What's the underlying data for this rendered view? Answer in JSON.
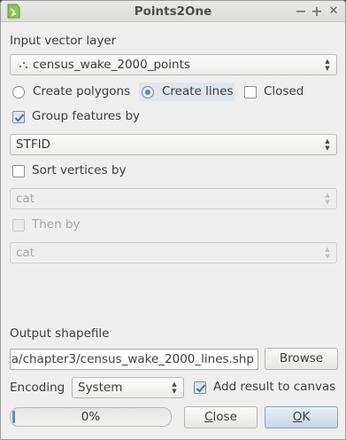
{
  "window": {
    "title": "Points2One",
    "controls": {
      "collapse": "−",
      "maximize": "+",
      "close": "✕"
    }
  },
  "input_layer": {
    "label": "Input vector layer",
    "selected": "census_wake_2000_points",
    "icon": "points-layer-icon"
  },
  "geometry": {
    "polygons_label": "Create polygons",
    "lines_label": "Create lines",
    "closed_label": "Closed",
    "selected": "lines",
    "closed_checked": false
  },
  "group": {
    "label": "Group features by",
    "checked": true,
    "field": "STFID"
  },
  "sort": {
    "label": "Sort vertices by",
    "checked": false,
    "field": "cat",
    "then_label": "Then by",
    "then_checked": false,
    "then_field": "cat"
  },
  "output": {
    "label": "Output shapefile",
    "path": "a/chapter3/census_wake_2000_lines.shp",
    "browse_label": "Browse"
  },
  "encoding": {
    "label": "Encoding",
    "value": "System",
    "add_result_label": "Add result to canvas",
    "add_result_checked": true
  },
  "progress": {
    "value": 0,
    "text": "0%"
  },
  "buttons": {
    "close_mnemonic": "C",
    "close_rest": "lose",
    "ok_mnemonic": "O",
    "ok_rest": "K"
  },
  "colors": {
    "accent": "#6d88aa",
    "progress_fill": "#5b8ac4",
    "title_bg": "#dcdcd9"
  }
}
